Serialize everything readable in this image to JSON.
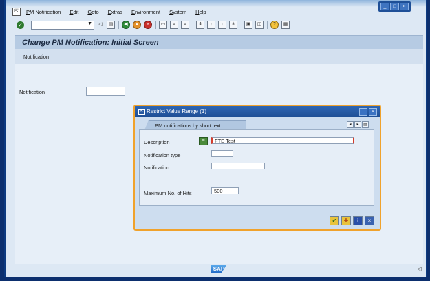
{
  "menu": {
    "items": [
      "PM Notification",
      "Edit",
      "Goto",
      "Extras",
      "Environment",
      "System",
      "Help"
    ]
  },
  "toolbar": {
    "command_field_value": "",
    "icons": [
      "enter-icon",
      "back-icon",
      "save-icon",
      "back-green-icon",
      "exit-icon",
      "cancel-icon",
      "print-icon",
      "find-icon",
      "find-next-icon",
      "first-page-icon",
      "prev-page-icon",
      "next-page-icon",
      "last-page-icon",
      "create-session-icon",
      "shortcut-icon",
      "help-icon",
      "layout-icon"
    ]
  },
  "screen": {
    "title": "Change PM Notification: Initial Screen",
    "app_toolbar_label": "Notification",
    "notification_label": "Notification",
    "notification_value": ""
  },
  "dialog": {
    "title": "Restrict Value Range (1)",
    "tab_label": "PM notifications by short text",
    "fields": {
      "description_label": "Description",
      "description_value": "FTE Test",
      "notification_type_label": "Notification type",
      "notification_type_value": "",
      "notification_label": "Notification",
      "notification_value": "",
      "max_hits_label": "Maximum No. of Hits",
      "max_hits_value": "500"
    },
    "buttons": [
      "continue-icon",
      "multiple-selection-icon",
      "info-icon",
      "cancel-icon"
    ]
  },
  "footer": {
    "logo_text": "SAP"
  },
  "colors": {
    "accent": "#f0a22c",
    "title_bar": "#1f4f95",
    "brand": "#1e66c4"
  }
}
